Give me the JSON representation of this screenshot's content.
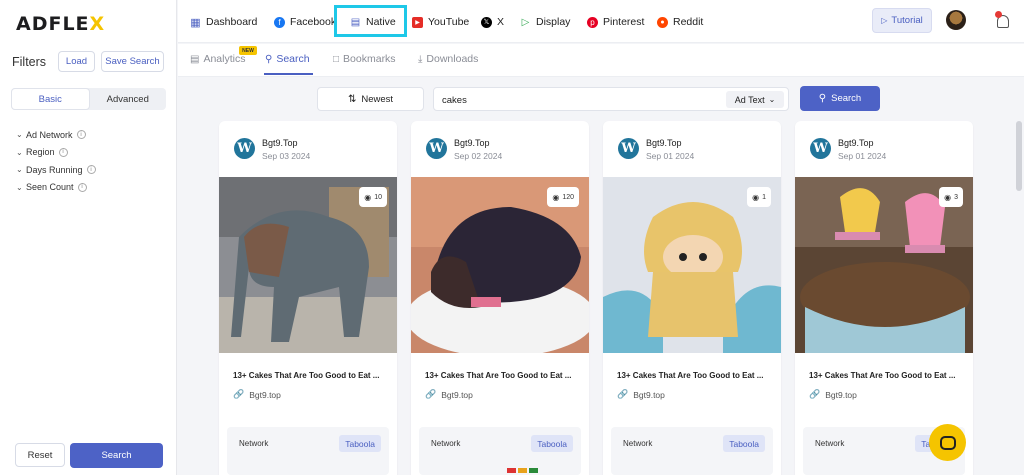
{
  "logo": {
    "text": "ADFLE",
    "accent": "X"
  },
  "sidebar": {
    "filters_title": "Filters",
    "load_label": "Load",
    "save_search_label": "Save Search",
    "tabs": [
      "Basic",
      "Advanced"
    ],
    "active_tab": "Basic",
    "filter_items": [
      "Ad Network",
      "Region",
      "Days Running",
      "Seen Count"
    ],
    "reset_label": "Reset",
    "search_label": "Search"
  },
  "topnav": {
    "items": [
      {
        "label": "Dashboard",
        "icon": "grid-icon"
      },
      {
        "label": "Facebook",
        "icon": "facebook-icon"
      },
      {
        "label": "Native",
        "icon": "native-icon"
      },
      {
        "label": "YouTube",
        "icon": "youtube-icon"
      },
      {
        "label": "X",
        "icon": "x-icon"
      },
      {
        "label": "Display",
        "icon": "display-icon"
      },
      {
        "label": "Pinterest",
        "icon": "pinterest-icon"
      },
      {
        "label": "Reddit",
        "icon": "reddit-icon"
      }
    ],
    "active": "Native",
    "tutorial_label": "Tutorial"
  },
  "subtabs": {
    "items": [
      "Analytics",
      "Search",
      "Bookmarks",
      "Downloads"
    ],
    "active": "Search",
    "new_badge": "NEW"
  },
  "searchbar": {
    "sort_label": "Newest",
    "query": "cakes",
    "type_label": "Ad Text",
    "search_label": "Search"
  },
  "cards": [
    {
      "source": "Bgt9.Top",
      "date": "Sep 03 2024",
      "views": "10",
      "title": "13+ Cakes That Are Too Good to Eat ...",
      "domain": "Bgt9.top",
      "network_label": "Network",
      "network": "Taboola"
    },
    {
      "source": "Bgt9.Top",
      "date": "Sep 02 2024",
      "views": "120",
      "title": "13+ Cakes That Are Too Good to Eat ...",
      "domain": "Bgt9.top",
      "network_label": "Network",
      "network": "Taboola"
    },
    {
      "source": "Bgt9.Top",
      "date": "Sep 01 2024",
      "views": "1",
      "title": "13+ Cakes That Are Too Good to Eat ...",
      "domain": "Bgt9.top",
      "network_label": "Network",
      "network": "Taboola"
    },
    {
      "source": "Bgt9.Top",
      "date": "Sep 01 2024",
      "views": "3",
      "title": "13+ Cakes That Are Too Good to Eat ...",
      "domain": "Bgt9.top",
      "network_label": "Network",
      "network": "Taboola"
    }
  ],
  "colors": {
    "accent": "#4d62c6",
    "brand_yellow": "#f5c400",
    "highlight": "#1ec8e8"
  }
}
